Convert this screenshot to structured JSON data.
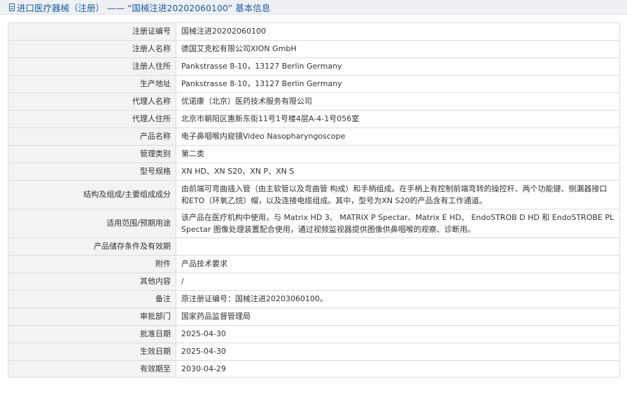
{
  "header": {
    "title": "进口医疗器械（注册） —— “国械注进20202060100” 基本信息"
  },
  "rows": [
    {
      "label": "注册证编号",
      "value": "国械注进20202060100"
    },
    {
      "label": "注册人名称",
      "value": "德国艾克松有限公司XION GmbH"
    },
    {
      "label": "注册人住所",
      "value": "Pankstrasse 8-10，13127 Berlin Germany"
    },
    {
      "label": "生产地址",
      "value": "Pankstrasse 8-10，13127 Berlin Germany"
    },
    {
      "label": "代理人名称",
      "value": "优诺康（北京）医药技术服务有限公司"
    },
    {
      "label": "代理人住所",
      "value": "北京市朝阳区惠新东街11号1号楼4层A-4-1号056室"
    },
    {
      "label": "产品名称",
      "value": "电子鼻咽喉内窥镜Video Nasopharyngoscope"
    },
    {
      "label": "管理类别",
      "value": "第二类"
    },
    {
      "label": "型号规格",
      "value": "XN HD、XN S20、XN P、XN S"
    },
    {
      "label": "结构及组成/主要组成成分",
      "value": "由前端可弯曲插入管（由主软管以及弯曲管 构成）和手柄组成。在手柄上有控制前端弯转的操控杆、两个功能键、侧漏器接口和ETO（环氧乙烷）帽，以及连接电缆组成。其中，型号为XN S20的产品含有工作通道。"
    },
    {
      "label": "适用范围/预期用途",
      "value": "该产品在医疗机构中使用，与 Matrix HD 3、 MATRIX P Spectar、Matrix E HD、 EndoSTROB D HD 和 EndoSTROBE PL Spectar 图像处理装置配合使用，通过视频监视器提供图像供鼻咽喉的观察、诊断用。"
    },
    {
      "label": "产品储存条件及有效期",
      "value": ""
    },
    {
      "label": "附件",
      "value": "产品技术要求"
    },
    {
      "label": "其他内容",
      "value": "/"
    },
    {
      "label": "备注",
      "value": "原注册证编号：国械注进20203060100。"
    },
    {
      "label": "审批部门",
      "value": "国家药品监督管理局"
    },
    {
      "label": "批准日期",
      "value": "2025-04-30"
    },
    {
      "label": "生效日期",
      "value": "2025-04-30"
    },
    {
      "label": "有效期至",
      "value": "2030-04-29"
    }
  ],
  "colors": {
    "title_text": "#1a5ea8",
    "title_bg": "#eef0f3",
    "label_bg": "#f3f3f3",
    "border": "#dcdcdc",
    "text": "#333333"
  },
  "icons": {
    "title_icon": "document-icon"
  }
}
